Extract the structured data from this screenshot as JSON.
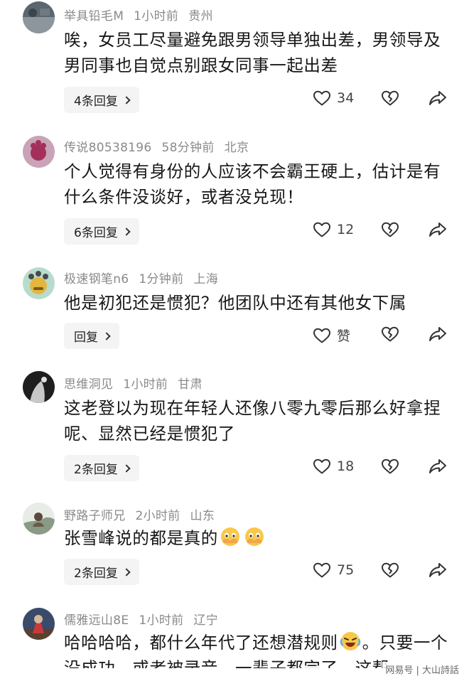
{
  "comments": [
    {
      "username": "举具铅毛M",
      "time": "1小时前",
      "location": "贵州",
      "text": "唉，女员工尽量避免跟男领导单独出差，男领导及男同事也自觉点别跟女同事一起出差",
      "reply_label": "4条回复",
      "likes": "34",
      "avatar_color": "#5a6670"
    },
    {
      "username": "传说80538196",
      "time": "58分钟前",
      "location": "北京",
      "text": "个人觉得有身份的人应该不会霸王硬上，估计是有什么条件没谈好，或者没兑现！",
      "reply_label": "6条回复",
      "likes": "12",
      "avatar_color": "#c9a3b7"
    },
    {
      "username": "极速钢笔n6",
      "time": "1分钟前",
      "location": "上海",
      "text": "他是初犯还是惯犯？他团队中还有其他女下属",
      "reply_label": "回复",
      "likes": "赞",
      "avatar_color": "#b7dccd"
    },
    {
      "username": "思维洞见",
      "time": "1小时前",
      "location": "甘肃",
      "text": "这老登以为现在年轻人还像八零九零后那么好拿捏呢、显然已经是惯犯了",
      "reply_label": "2条回复",
      "likes": "18",
      "avatar_color": "#222222"
    },
    {
      "username": "野路子师兄",
      "time": "2小时前",
      "location": "山东",
      "text": "张雪峰说的都是真的",
      "reply_label": "2条回复",
      "likes": "75",
      "avatar_color": "#9aa59a"
    },
    {
      "username": "儒雅远山8E",
      "time": "1小时前",
      "location": "辽宁",
      "text_part1": "哈哈哈哈，都什么年代了还想潜规则",
      "text_part2": "。只要一个没成功，或者被录音，一辈子都完了，这帮",
      "avatar_color": "#3a4a6a"
    }
  ],
  "icons": {
    "like": "heart-outline-icon",
    "dislike": "broken-heart-icon",
    "share": "share-arrow-icon",
    "chevron": "chevron-right-icon"
  },
  "watermark": "网易号 | 大山詩話"
}
